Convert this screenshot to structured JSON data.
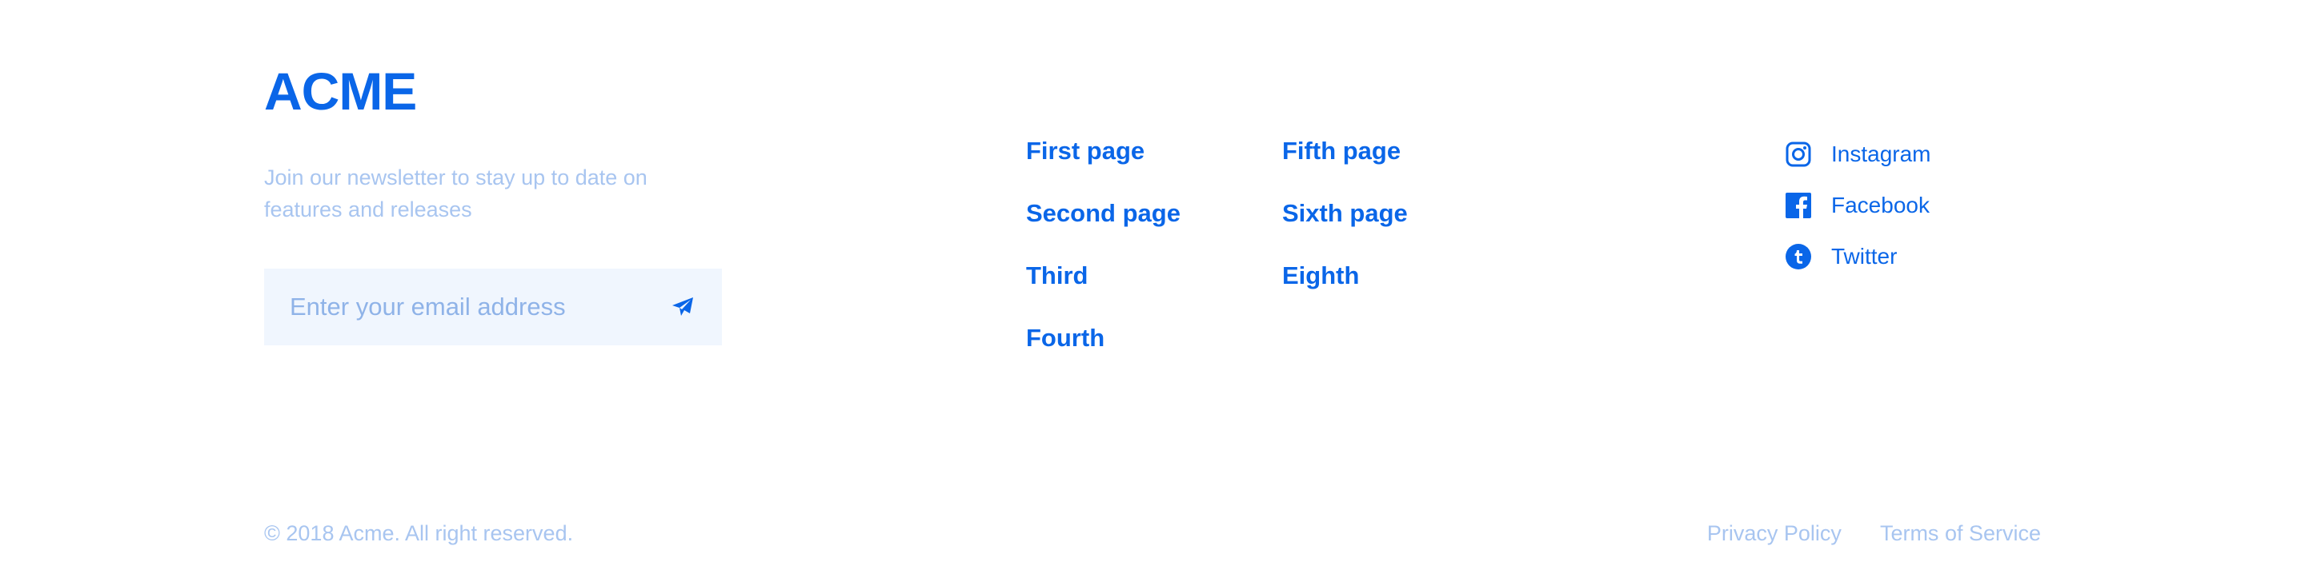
{
  "brand": {
    "logo": "ACME"
  },
  "newsletter": {
    "text": "Join our newsletter to stay up to date on features and releases",
    "email_placeholder": "Enter your email address",
    "submit_icon": "send-icon"
  },
  "nav": {
    "column1": [
      "First page",
      "Second page",
      "Third",
      "Fourth"
    ],
    "column2": [
      "Fifth page",
      "Sixth page",
      "Eighth"
    ]
  },
  "social": [
    {
      "label": "Instagram",
      "icon": "instagram-icon"
    },
    {
      "label": "Facebook",
      "icon": "facebook-icon"
    },
    {
      "label": "Twitter",
      "icon": "twitter-icon"
    }
  ],
  "footer": {
    "copyright": "© 2018 Acme. All right reserved.",
    "privacy": "Privacy Policy",
    "terms": "Terms of Service"
  },
  "colors": {
    "accent": "#0a66e8",
    "muted": "#a8c5f0",
    "input_bg": "#f0f6fe"
  }
}
